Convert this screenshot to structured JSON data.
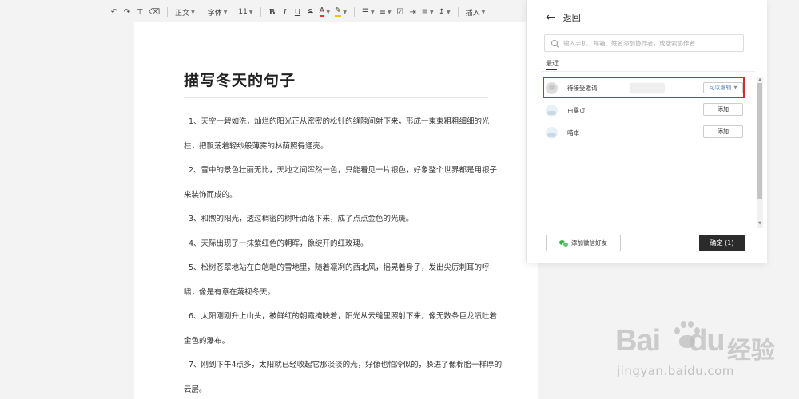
{
  "toolbar": {
    "paragraph_style": "正文",
    "font_family": "字体",
    "font_size": "11",
    "insert_label": "插入"
  },
  "document": {
    "title": "描写冬天的句子",
    "lines": [
      "1、天空一碧如洗，灿烂的阳光正从密密的松针的缝隙间射下来，形成一束束粗粗细细的光",
      "柱，把飘荡着轻纱般薄雾的林荫照得通亮。",
      "2、雪中的景色壮丽无比，天地之间浑然一色，只能看见一片银色，好象整个世界都是用银子",
      "来装饰而成的。",
      "3、和煦的阳光，透过稠密的树叶洒落下来，成了点点金色的光斑。",
      "4、天际出现了一抹紫红色的朝晖，像绽开的红玫瑰。",
      "5、松树苍翠地站在白皑皑的雪地里，随着凛冽的西北风，摇晃着身子，发出尖厉刺耳的呼",
      "啸，像是有意在蔑视冬天。",
      "6、太阳刚刚升上山头，被鲜红的朝霞掩映着，阳光从云缝里照射下来，像无数条巨龙喷吐着",
      "金色的瀑布。",
      "7、刚到下午4点多，太阳就已经收起它那淡淡的光，好像也怕冷似的，躲进了像棉胎一样厚的",
      "云层。"
    ]
  },
  "panel": {
    "back_label": "返回",
    "search_placeholder": "输入手机、邮箱、姓名添加协作者，或搜索协作者",
    "recent_label": "最近",
    "users": [
      {
        "name": "待接受邀请",
        "action": "可以编辑"
      },
      {
        "name": "白雾贞",
        "action": "添加"
      },
      {
        "name": "喵本",
        "action": "添加"
      }
    ],
    "wechat_button": "添加微信好友",
    "confirm_button": "确定 (1)"
  },
  "watermark": {
    "logo_text": "Bai",
    "logo_suffix": "du",
    "cn_text": "经验",
    "url": "jingyan.baidu.com"
  },
  "colors": {
    "highlight": "#d8272e",
    "link_blue": "#4a7fc1",
    "confirm_bg": "#2b2b2b"
  }
}
